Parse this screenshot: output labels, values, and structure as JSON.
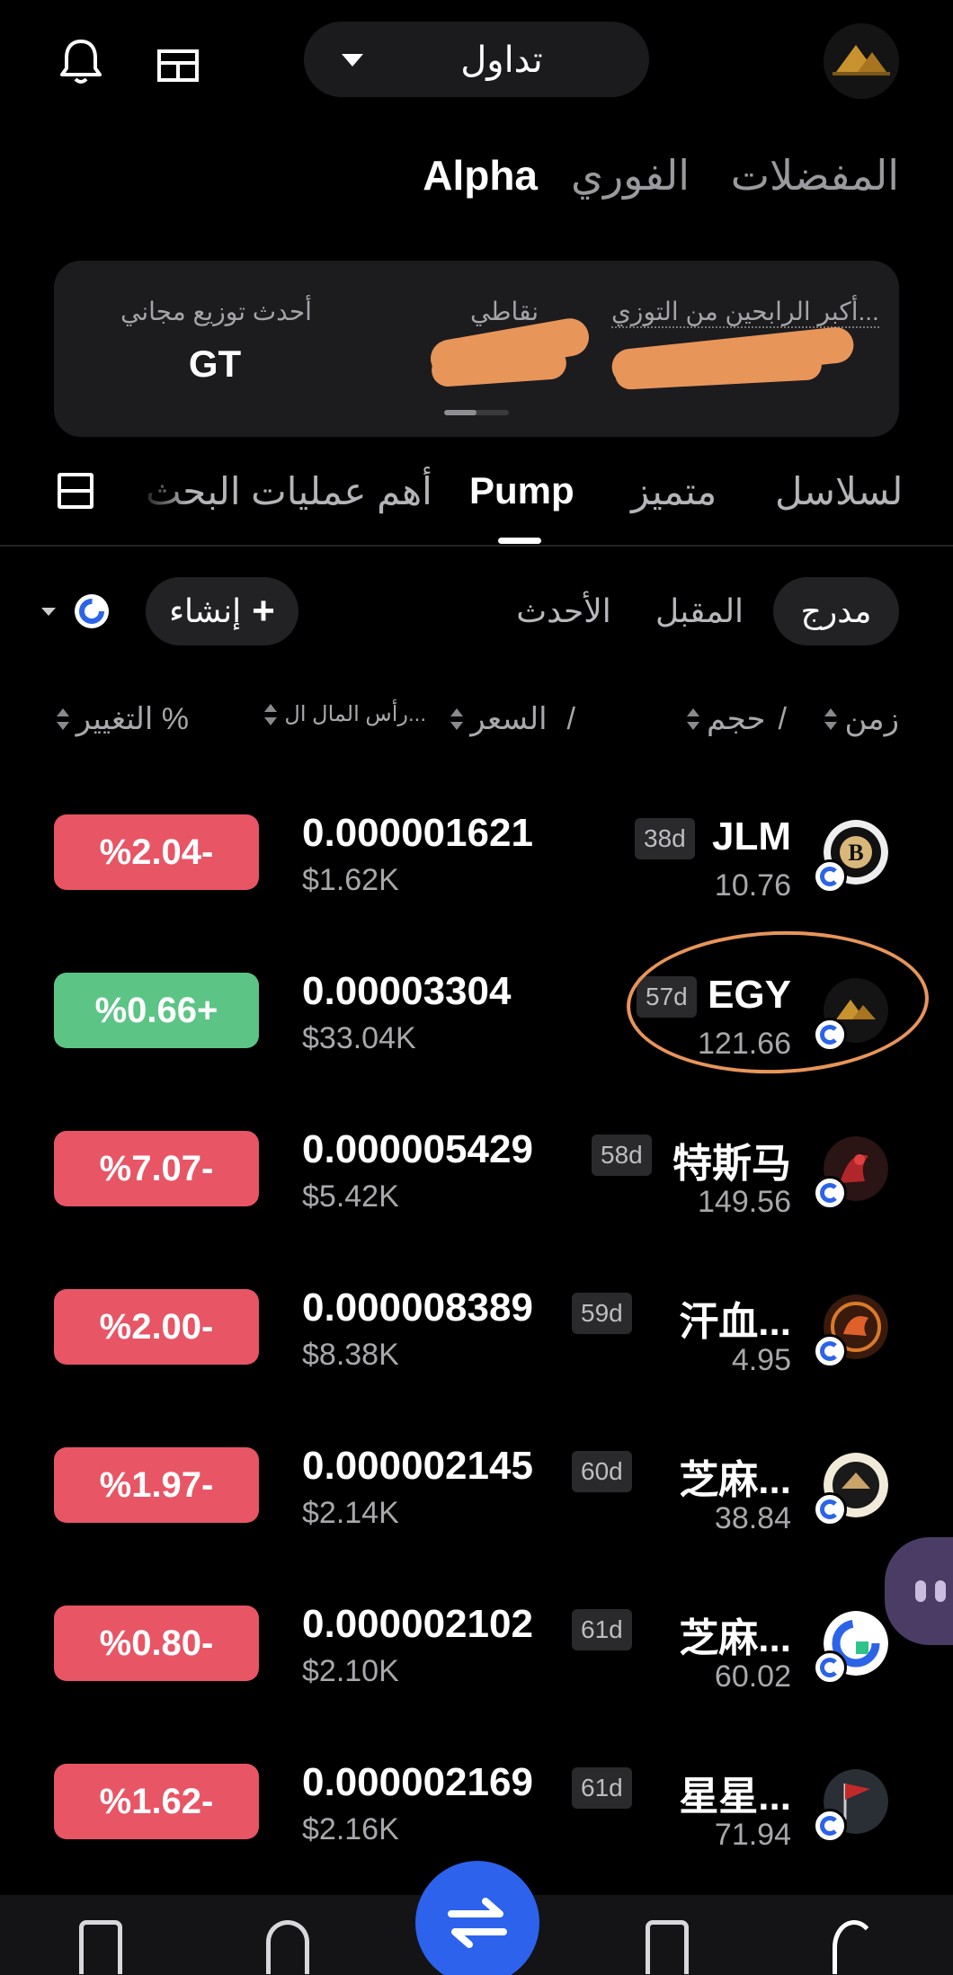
{
  "header": {
    "mode_label": "تداول",
    "icons": {
      "notifications": "bell-icon",
      "layout": "layout-icon",
      "caret": "caret-down-icon"
    },
    "avatar": "Egypt"
  },
  "main_tabs": [
    {
      "label": "المفضلات",
      "active": false
    },
    {
      "label": "الفوري",
      "active": false
    },
    {
      "label": "Alpha",
      "active": true
    }
  ],
  "info_card": {
    "latest_airdrop_label": "أحدث توزيع مجاني",
    "latest_airdrop_value": "GT",
    "my_points_label": "نقاطي",
    "top_earners_label": "أكبر الرابحين من التوزي...",
    "top_earners_value_visible": "1"
  },
  "category_tabs": [
    {
      "label": "لسلاسل",
      "active": false
    },
    {
      "label": "متميز",
      "active": false
    },
    {
      "label": "Pump",
      "active": true
    },
    {
      "label": "أهم عمليات البحث",
      "active": false
    }
  ],
  "filters": {
    "segments": [
      {
        "label": "مدرج",
        "active": true
      },
      {
        "label": "المقبل",
        "active": false
      },
      {
        "label": "الأحدث",
        "active": false
      }
    ],
    "create_label": "إنشاء",
    "create_plus": "+"
  },
  "column_headers": {
    "time": "زمن",
    "slash1": "/",
    "volume": "حجم",
    "price": "السعر",
    "slash2": "/",
    "market_cap": "رأس المال ال...",
    "change": "التغيير %"
  },
  "rows": [
    {
      "change": "%2.04-",
      "direction": "down",
      "price": "0.000001621",
      "mcap": "$1.62K",
      "name": "JLM",
      "age": "38d",
      "volume": "10.76"
    },
    {
      "change": "%0.66+",
      "direction": "up",
      "price": "0.00003304",
      "mcap": "$33.04K",
      "name": "EGY",
      "age": "57d",
      "volume": "121.66"
    },
    {
      "change": "%7.07-",
      "direction": "down",
      "price": "0.000005429",
      "mcap": "$5.42K",
      "name": "特斯马",
      "age": "58d",
      "volume": "149.56"
    },
    {
      "change": "%2.00-",
      "direction": "down",
      "price": "0.000008389",
      "mcap": "$8.38K",
      "name": "汗血...",
      "age": "59d",
      "volume": "4.95"
    },
    {
      "change": "%1.97-",
      "direction": "down",
      "price": "0.000002145",
      "mcap": "$2.14K",
      "name": "芝麻...",
      "age": "60d",
      "volume": "38.84"
    },
    {
      "change": "%0.80-",
      "direction": "down",
      "price": "0.000002102",
      "mcap": "$2.10K",
      "name": "芝麻...",
      "age": "61d",
      "volume": "60.02"
    },
    {
      "change": "%1.62-",
      "direction": "down",
      "price": "0.000002169",
      "mcap": "$2.16K",
      "name": "星星...",
      "age": "61d",
      "volume": "71.94"
    }
  ],
  "colors": {
    "negative": "#e85565",
    "positive": "#5cc485",
    "accent": "#2d62ec",
    "annotation": "#e8955a"
  },
  "bottom_nav": [
    "wallet-icon",
    "rewards-icon",
    "swap-icon",
    "futures-icon",
    "alpha-icon"
  ]
}
